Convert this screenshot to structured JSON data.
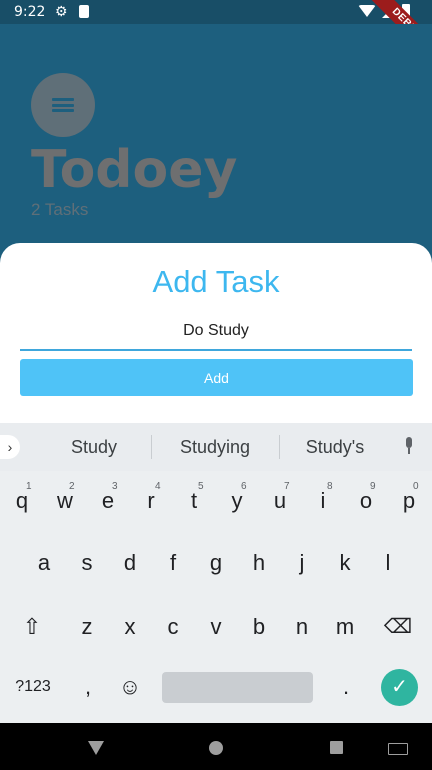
{
  "status_bar": {
    "time": "9:22"
  },
  "debug_banner": "DEBUG",
  "header": {
    "title": "Todoey",
    "task_count": "2 Tasks"
  },
  "sheet": {
    "title": "Add Task",
    "input_value": "Do Study",
    "add_label": "Add"
  },
  "keyboard": {
    "suggestions": [
      "Study",
      "Studying",
      "Study's"
    ],
    "row1": [
      "q",
      "w",
      "e",
      "r",
      "t",
      "y",
      "u",
      "i",
      "o",
      "p"
    ],
    "row1_hints": [
      "1",
      "2",
      "3",
      "4",
      "5",
      "6",
      "7",
      "8",
      "9",
      "0"
    ],
    "row2": [
      "a",
      "s",
      "d",
      "f",
      "g",
      "h",
      "j",
      "k",
      "l"
    ],
    "row3": [
      "z",
      "x",
      "c",
      "v",
      "b",
      "n",
      "m"
    ],
    "sym_label": "?123",
    "comma": ",",
    "period": "."
  },
  "colors": {
    "accent": "#3db7ef",
    "button": "#4fc3f7",
    "header_bg": "#1d5f7e",
    "enter": "#2fb5a0"
  }
}
